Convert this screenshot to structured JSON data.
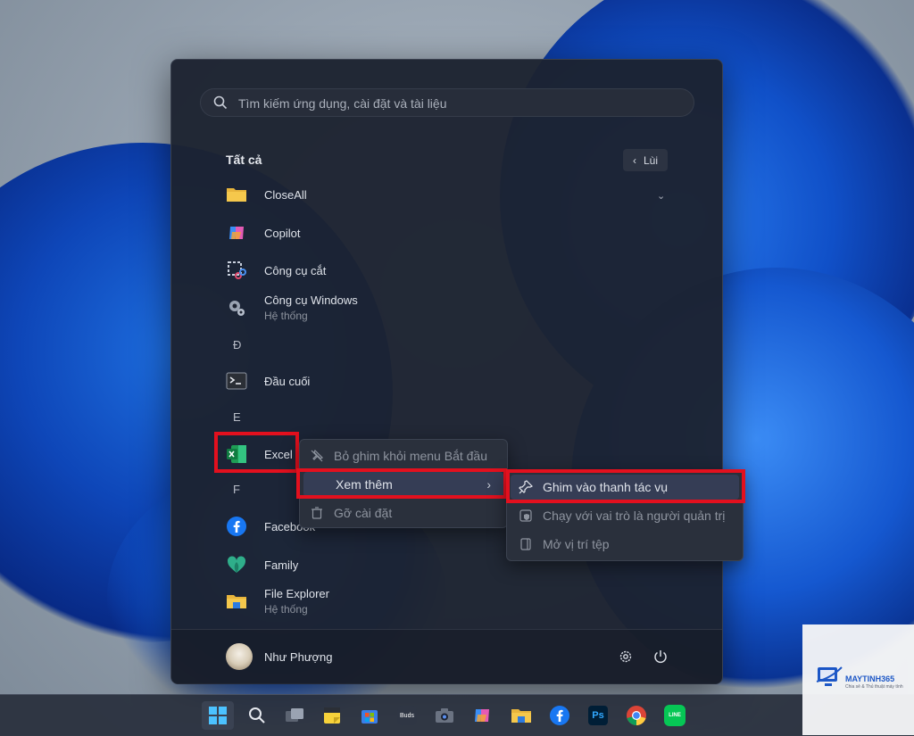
{
  "search": {
    "placeholder": "Tìm kiếm ứng dụng, cài đặt và tài liệu"
  },
  "all_apps": {
    "title": "Tất cả",
    "back_label": "Lùi",
    "items": [
      {
        "name": "CloseAll",
        "sub": "",
        "icon": "folder-icon"
      },
      {
        "name": "Copilot",
        "sub": "",
        "icon": "copilot-icon"
      },
      {
        "name": "Công cụ cắt",
        "sub": "",
        "icon": "snipping-tool-icon"
      },
      {
        "name": "Công cụ Windows",
        "sub": "Hệ thống",
        "icon": "windows-tools-icon"
      },
      {
        "name": "Đầu cuối",
        "sub": "",
        "icon": "terminal-icon"
      },
      {
        "name": "Excel",
        "sub": "",
        "icon": "excel-icon"
      },
      {
        "name": "Facebook",
        "sub": "",
        "icon": "facebook-icon"
      },
      {
        "name": "Family",
        "sub": "",
        "icon": "family-icon"
      },
      {
        "name": "File Explorer",
        "sub": "Hệ thống",
        "icon": "file-explorer-icon"
      }
    ],
    "letters": [
      "Đ",
      "E",
      "F"
    ]
  },
  "context_menu": {
    "unpin": "Bỏ ghim khỏi menu Bắt đầu",
    "more": "Xem thêm",
    "uninstall": "Gỡ cài đặt"
  },
  "submenu": {
    "pin_taskbar": "Ghim vào thanh tác vụ",
    "run_admin": "Chạy với vai trò là người quản trị",
    "open_location": "Mở vị trí tệp"
  },
  "user": {
    "name": "Như Phượng"
  },
  "taskbar": {
    "icons": [
      "start-icon",
      "search-icon",
      "task-view-icon",
      "sticky-notes-icon",
      "store-icon",
      "buds-icon",
      "camera-icon",
      "copilot-icon",
      "file-explorer-icon",
      "facebook-icon",
      "photoshop-icon",
      "chrome-icon",
      "line-icon"
    ],
    "buds_label": "Buds",
    "ps_label": "Ps",
    "line_label": "LINE"
  },
  "watermark": {
    "brand": "MAYTINH365",
    "tagline": "Chia sẻ & Thủ thuật máy tính"
  }
}
